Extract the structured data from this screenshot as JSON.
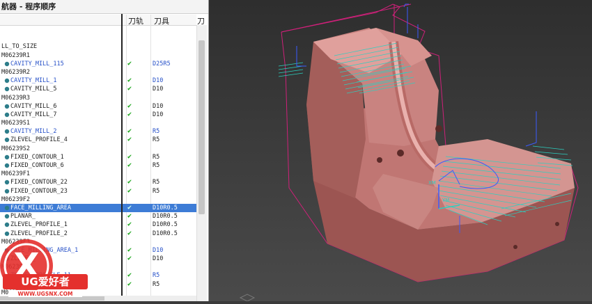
{
  "navigator": {
    "title": "航器 - 程序顺序",
    "columns": {
      "name": "",
      "toolpath": "刀轨",
      "tool": "刀具",
      "extra": "刀"
    },
    "rows": [
      {
        "name": "",
        "type": "blank",
        "check": false,
        "tool": ""
      },
      {
        "name": "",
        "type": "blank",
        "check": false,
        "tool": ""
      },
      {
        "name": "LL_TO_SIZE",
        "type": "group",
        "check": false,
        "tool": ""
      },
      {
        "name": "M06239R1",
        "type": "group",
        "check": false,
        "tool": ""
      },
      {
        "name": "CAVITY_MILL_115",
        "type": "op",
        "blue": true,
        "check": true,
        "tool": "D25R5"
      },
      {
        "name": "M06239R2",
        "type": "group",
        "check": false,
        "tool": ""
      },
      {
        "name": "CAVITY_MILL_1",
        "type": "op",
        "blue": true,
        "check": true,
        "tool": "D10"
      },
      {
        "name": "CAVITY_MILL_5",
        "type": "op",
        "blue": false,
        "check": true,
        "tool": "D10"
      },
      {
        "name": "M06239R3",
        "type": "group",
        "check": false,
        "tool": ""
      },
      {
        "name": "CAVITY_MILL_6",
        "type": "op",
        "blue": false,
        "check": true,
        "tool": "D10"
      },
      {
        "name": "CAVITY_MILL_7",
        "type": "op",
        "blue": false,
        "check": true,
        "tool": "D10"
      },
      {
        "name": "M06239S1",
        "type": "group",
        "check": false,
        "tool": ""
      },
      {
        "name": "CAVITY_MILL_2",
        "type": "op",
        "blue": true,
        "check": true,
        "tool": "R5"
      },
      {
        "name": "ZLEVEL_PROFILE_4",
        "type": "op",
        "blue": false,
        "check": true,
        "tool": "R5"
      },
      {
        "name": "M06239S2",
        "type": "group",
        "check": false,
        "tool": ""
      },
      {
        "name": "FIXED_CONTOUR_1",
        "type": "op",
        "blue": false,
        "check": true,
        "tool": "R5"
      },
      {
        "name": "FIXED_CONTOUR_6",
        "type": "op",
        "blue": false,
        "check": true,
        "tool": "R5"
      },
      {
        "name": "M06239F1",
        "type": "group",
        "check": false,
        "tool": ""
      },
      {
        "name": "FIXED_CONTOUR_22",
        "type": "op",
        "blue": false,
        "check": true,
        "tool": "R5"
      },
      {
        "name": "FIXED_CONTOUR_23",
        "type": "op",
        "blue": false,
        "check": true,
        "tool": "R5"
      },
      {
        "name": "M06239F2",
        "type": "group",
        "check": false,
        "tool": ""
      },
      {
        "name": "FACE_MILLING_AREA",
        "type": "op",
        "blue": true,
        "check": true,
        "tool": "D10R0.5",
        "selected": true
      },
      {
        "name": "PLANAR_",
        "type": "op",
        "blue": false,
        "check": true,
        "tool": "D10R0.5"
      },
      {
        "name": "ZLEVEL_PROFILE_1",
        "type": "op",
        "blue": false,
        "check": true,
        "tool": "D10R0.5"
      },
      {
        "name": "ZLEVEL_PROFILE_2",
        "type": "op",
        "blue": false,
        "check": true,
        "tool": "D10R0.5"
      },
      {
        "name": "M06239F3",
        "type": "group",
        "check": false,
        "tool": ""
      },
      {
        "name": "FACE_MILLING_AREA_1",
        "type": "op",
        "blue": true,
        "check": true,
        "tool": "D10"
      },
      {
        "name": "ZLEVEL_",
        "type": "op",
        "blue": false,
        "check": true,
        "tool": "D10"
      },
      {
        "name": "M06239",
        "type": "group",
        "check": false,
        "tool": ""
      },
      {
        "name": "ZLEVEL_PROFILE_11",
        "type": "op",
        "blue": true,
        "check": true,
        "tool": "R5"
      },
      {
        "name": "FIXED_CONTOUR_4",
        "type": "op",
        "blue": false,
        "check": true,
        "tool": "R5"
      },
      {
        "name": "M06239F5",
        "type": "group",
        "check": false,
        "tool": ""
      }
    ]
  },
  "viewport": {
    "labels": {
      "ym": "YM",
      "xm": "XM"
    }
  },
  "watermark": {
    "brand": "UG爱好者",
    "url": "WWW.UGSNX.COM"
  },
  "colors": {
    "selection": "#3d7cd6",
    "check": "#1aa51a",
    "part": "#d98a86",
    "toolpath": "#2bd0c0"
  }
}
